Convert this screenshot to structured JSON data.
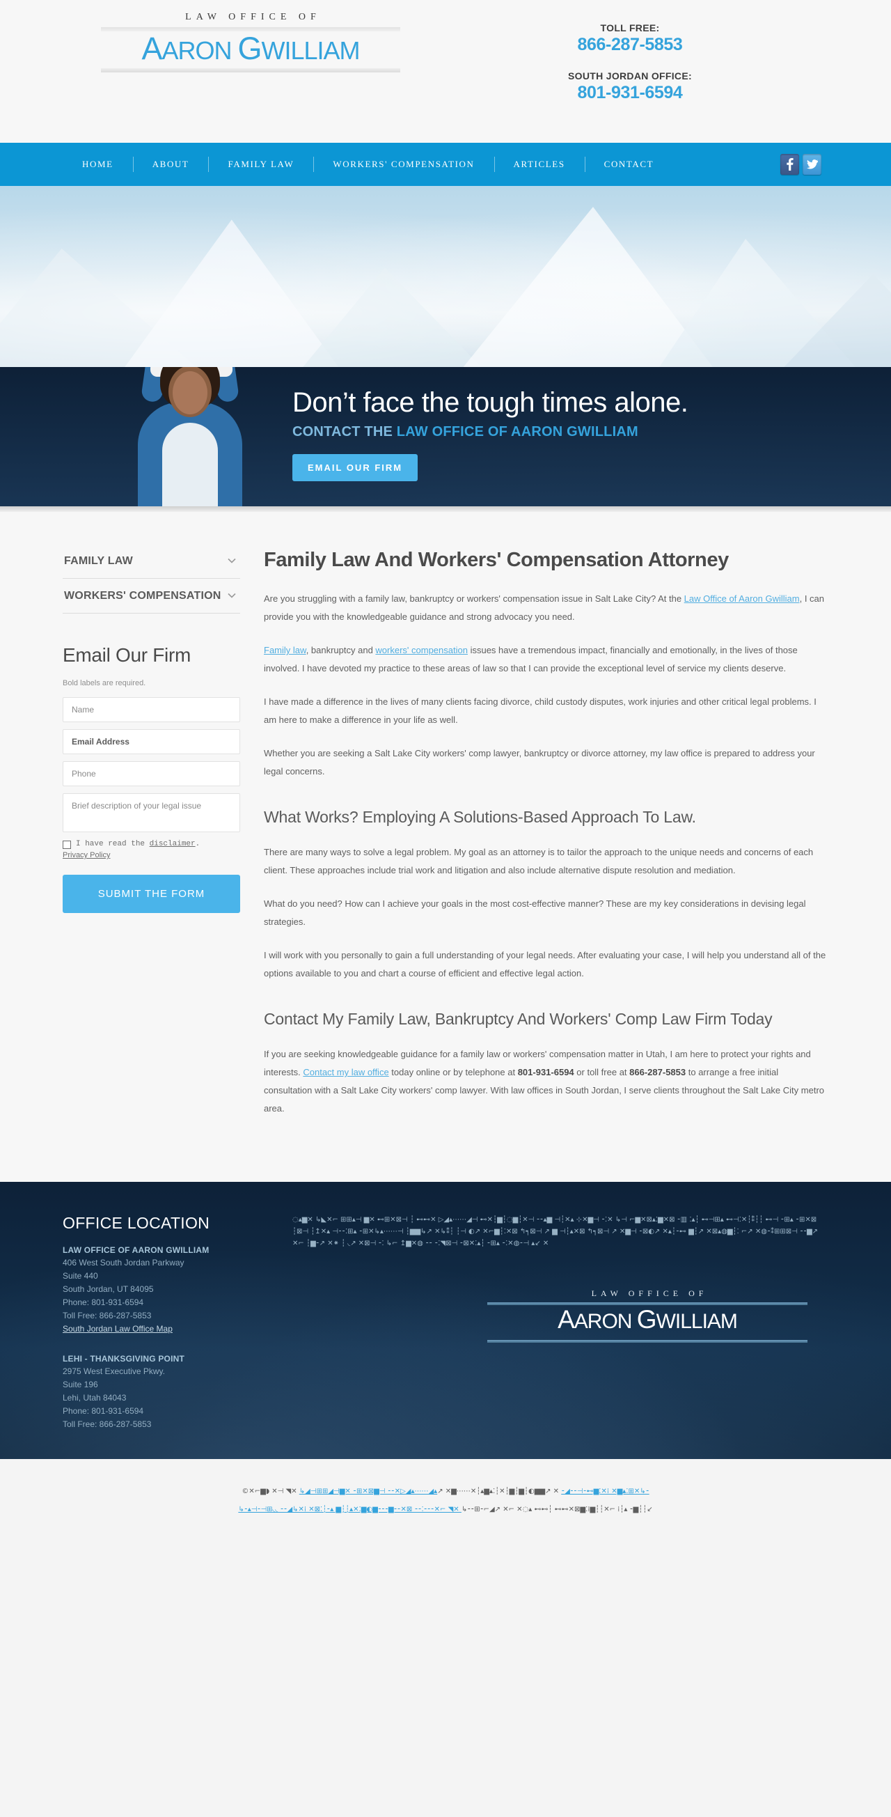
{
  "header": {
    "logo_kicker": "LAW OFFICE OF",
    "logo_name_a": "A",
    "logo_name_aron": "ARON ",
    "logo_name_g": "G",
    "logo_name_willliam": "WILLIAM",
    "tollfree_label": "TOLL FREE:",
    "tollfree_number": "866-287-5853",
    "office_label": "SOUTH JORDAN OFFICE:",
    "office_number": "801-931-6594"
  },
  "nav": {
    "items": [
      {
        "label": "HOME"
      },
      {
        "label": "ABOUT"
      },
      {
        "label": "FAMILY LAW"
      },
      {
        "label": "WORKERS' COMPENSATION"
      },
      {
        "label": "ARTICLES"
      },
      {
        "label": "CONTACT"
      }
    ],
    "social": [
      {
        "name": "facebook",
        "label": "f"
      },
      {
        "name": "twitter",
        "label": "t"
      }
    ]
  },
  "hero": {
    "headline": "Don’t face the tough times alone.",
    "subhead_prefix": "CONTACT THE ",
    "subhead_strong": "LAW OFFICE OF AARON GWILLIAM",
    "cta_label": "EMAIL OUR FIRM"
  },
  "sidebar": {
    "accordion": [
      {
        "label": "FAMILY LAW"
      },
      {
        "label": "WORKERS' COMPENSATION"
      }
    ],
    "form": {
      "title": "Email Our Firm",
      "note": "Bold labels are required.",
      "name_placeholder": "Name",
      "email_placeholder": "Email Address",
      "phone_placeholder": "Phone",
      "message_placeholder": "Brief description of your legal issue",
      "disclaimer_pre": "I have read the ",
      "disclaimer_link": "disclaimer",
      "disclaimer_post": ".",
      "privacy_label": "Privacy Policy",
      "submit_label": "SUBMIT THE FORM"
    }
  },
  "content": {
    "h1": "Family Law And Workers' Compensation Attorney",
    "p1_a": "Are you struggling with a family law, bankruptcy or workers' compensation issue in Salt Lake City? At the ",
    "p1_link": "Law Office of Aaron Gwilliam",
    "p1_b": ", I can provide you with the knowledgeable guidance and strong advocacy you need.",
    "p2_link1": "Family law",
    "p2_a": ", bankruptcy and ",
    "p2_link2": "workers' compensation",
    "p2_b": " issues have a tremendous impact, financially and emotionally, in the lives of those involved. I have devoted my practice to these areas of law so that I can provide the exceptional level of service my clients deserve.",
    "p3": "I have made a difference in the lives of many clients facing divorce, child custody disputes, work injuries and other critical legal problems. I am here to make a difference in your life as well.",
    "p4": "Whether you are seeking a Salt Lake City workers' comp lawyer, bankruptcy or divorce attorney, my law office is prepared to address your legal concerns.",
    "h2_a": "What Works? Employing A Solutions-Based Approach To Law.",
    "p5": "There are many ways to solve a legal problem. My goal as an attorney is to tailor the approach to the unique needs and concerns of each client. These approaches include trial work and litigation and also include alternative dispute resolution and mediation.",
    "p6": "What do you need? How can I achieve your goals in the most cost-effective manner? These are my key considerations in devising legal strategies.",
    "p7": "I will work with you personally to gain a full understanding of your legal needs. After evaluating your case, I will help you understand all of the options available to you and chart a course of efficient and effective legal action.",
    "h2_b": "Contact My Family Law, Bankruptcy And Workers' Comp Law Firm Today",
    "p8_a": "If you are seeking knowledgeable guidance for a family law or workers' compensation matter in Utah, I am here to protect your rights and interests. ",
    "p8_link": "Contact my law office",
    "p8_b": " today online or by telephone at ",
    "p8_phone1": "801-931-6594",
    "p8_c": " or toll free at ",
    "p8_phone2": "866-287-5853",
    "p8_d": " to arrange a free initial consultation with a Salt Lake City workers' comp lawyer. With law offices in South Jordan, I serve clients throughout the Salt Lake City metro area."
  },
  "footer": {
    "heading": "OFFICE LOCATION",
    "offices": [
      {
        "name": "LAW OFFICE OF AARON GWILLIAM",
        "lines": [
          "406 West South Jordan Parkway",
          "Suite 440",
          "South Jordan, UT 84095",
          "Phone: 801-931-6594",
          "Toll Free: 866-287-5853"
        ],
        "map_link": "South Jordan Law Office Map"
      },
      {
        "name": "LEHI - THANKSGIVING POINT",
        "lines": [
          "2975 West Executive Pkwy.",
          "Suite 196",
          "Lehi, Utah 84043",
          "Phone: 801-931-6594",
          "Toll Free: 866-287-5853"
        ],
        "map_link": ""
      }
    ],
    "garbled_paragraph": "◌▴▆✕ ↳◣✕⌐ ⊞⊞▴⊣ ▆✕ ⊷⊞✕⊠⊣ ┆ ⊷⊷✕ ▷◢▴⋯⋯◢⊣ ⊷✕┆▆┆◌▆┆✕⊣ ⁃⁃▴▆ ⊣┆✕▴ ⊹✕▆⊣ ⁃⁚✕ ↳⊣ ⌐▆✕⊠▴⁚▆✕⊠ ⁃▥ ⁚▴┆ ⊷⊣⊞▴ ⊷⊣⁚✕┆⁑┆┆ ⊷⊣ ⁃⊞▴ ⁃⊞✕⊠ ┆⊠⊣ ┆↥✕▴ ⊣⁃⁃⁚⊞▴ ⁃⊞✕↳▴⋯⋯⊣ ┆▆▆↳↗ ✕↳⁑┆ ┆⊣ ◐↗ ✕⌐▆┆⁚✕⊠ ↰┑⊠⊣ ↗ ▆ ⊣┆▴✕⊠ ↰┑⊠⊣ ↗ ✕▆⊣ ⁃⊠◐↗ ✕▴┆⁃⊷ ▆┆↗ ✕⊠▴◍▆┆⁚ ⌐↗ ✕◍⁃⁑⊞⊞⊠⊣ ⁃⁃▆↗ ✕⌐ ┆▆⁃↗ ✕⁕ ┆ ◟↗ ✕⊠⊣ ⁃⁚ ↳⌐ ↥▆✕◍ ⁃⁃ ⁃⁚◥⊠⊣ ⁃⊠✕⁚▴┆ ⁃⊞▴ ⁃⁚✕◍⁃⊣ ▴↙ ✕",
    "logo_kicker": "LAW OFFICE OF",
    "logo_name_a": "A",
    "logo_name_aron": "ARON ",
    "logo_name_g": "G",
    "logo_name_willliam": "WILLIAM"
  },
  "bottombar": {
    "garbled_line1_a": "©✕⌐▆◗ ✕⊣ ◥✕ ",
    "garbled_line1_link": "↳◢⊣⊞⊞◢⊣▆✕ ⁃⊞✕⊠▆⊣ ⁃⁃✕▷◢▴⋯⋯◢▴",
    "garbled_line1_b": "↗ ✕▆⋯⋯✕┆▴▆▴⁚┆✕┆▆┆▆┆◐▆▆↗ ✕ ",
    "garbled_line1_link2": "⁃◢⁃⁃⊣⁃⊷▆⁚✕⁞ ✕▆▴⁚⊞✕↳⁃",
    "garbled_line2_a": "↳⁃▴⊣⁃⊣⊞◟◟ ⁃⁃◢↳✕⁞ ✕⊠⁚┆⁃▴ ▆┆┆▴✕⁚▆◐▆⁃⁃⁃▆⁃⁃✕⊠ ⁃⁃⁚⁃⁃⁃✕⌐ ◥✕ ",
    "garbled_line2_link": "↳⁃⁃⊞⁃⌐◢↗ ✕⌐ ✕◌▴ ⊷⊷┆ ⊷⊷✕⊠▆⁚⁞▆┆┆✕⌐ ⁞┆▴ ⁃▆┆┆↙"
  }
}
